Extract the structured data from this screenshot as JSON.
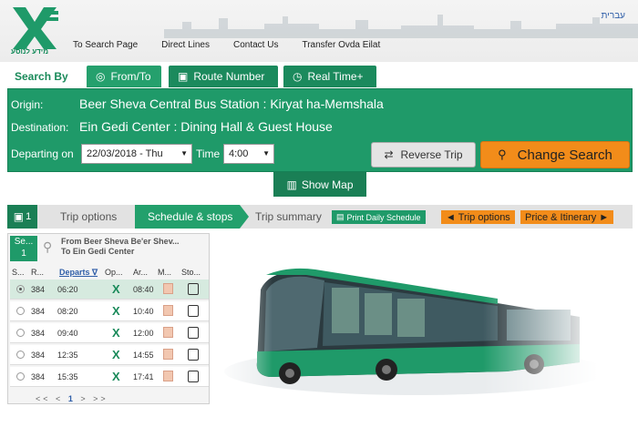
{
  "header": {
    "logo_subtitle": "מידע לנוסע",
    "lang_link": "עברית",
    "nav": [
      "To Search Page",
      "Direct Lines",
      "Contact Us",
      "Transfer Ovda Eilat"
    ]
  },
  "search": {
    "label": "Search By",
    "tabs": [
      {
        "label": "From/To",
        "icon": "compass-icon"
      },
      {
        "label": "Route Number",
        "icon": "bus-icon"
      },
      {
        "label": "Real Time+",
        "icon": "clock-icon"
      }
    ],
    "origin_label": "Origin:",
    "origin_value": "Beer Sheva Central Bus Station : Kiryat ha-Memshala",
    "destination_label": "Destination:",
    "destination_value": "Ein Gedi Center : Dining Hall & Guest House",
    "departing_label": "Departing on",
    "date_value": "22/03/2018 - Thu",
    "time_label": "Time",
    "time_value": "4:00",
    "reverse_label": "Reverse Trip",
    "change_label": "Change Search",
    "show_map_label": "Show Map"
  },
  "steps": {
    "icon_text": "1",
    "trip_options": "Trip options",
    "schedule": "Schedule & stops",
    "summary": "Trip summary",
    "print_label": "Print Daily Schedule",
    "back_label": "◄ Trip options",
    "price_label": "Price & Itinerary ►"
  },
  "trip": {
    "segment_label": "Se...",
    "segment_number": "1",
    "route_line1": "From Beer Sheva Be'er Shev...",
    "route_line2": "To Ein Gedi Center",
    "columns": [
      "S...",
      "R...",
      "Departs",
      "Op...",
      "Ar...",
      "M...",
      "Sto..."
    ],
    "rows": [
      {
        "route": "384",
        "departs": "06:20",
        "arrives": "08:40",
        "selected": true
      },
      {
        "route": "384",
        "departs": "08:20",
        "arrives": "10:40",
        "selected": false
      },
      {
        "route": "384",
        "departs": "09:40",
        "arrives": "12:00",
        "selected": false
      },
      {
        "route": "384",
        "departs": "12:35",
        "arrives": "14:55",
        "selected": false
      },
      {
        "route": "384",
        "departs": "15:35",
        "arrives": "17:41",
        "selected": false
      }
    ],
    "pager": {
      "first": "<<",
      "prev": "<",
      "page": "1",
      "next": ">",
      "last": ">>"
    }
  },
  "colors": {
    "brand_green": "#1f9a69",
    "dark_green": "#1a7f55",
    "orange": "#f28c1a"
  }
}
